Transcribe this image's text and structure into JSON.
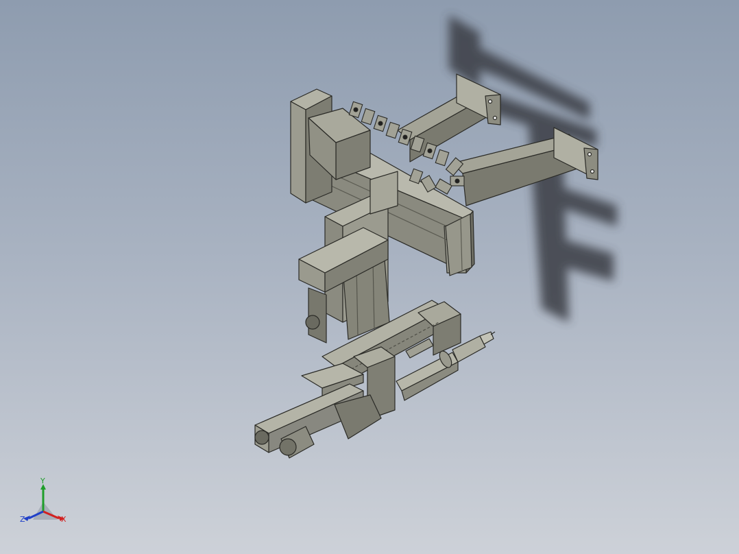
{
  "viewport": {
    "background_top": "#8e9caf",
    "background_bottom": "#cdd1d8",
    "model_color": "#8f8f84",
    "shadow_color": "#3a3d44"
  },
  "triad": {
    "x_label": "X",
    "y_label": "Y",
    "z_label": "Z",
    "x_color": "#d22020",
    "y_color": "#1f9e2a",
    "z_color": "#2040c8"
  }
}
